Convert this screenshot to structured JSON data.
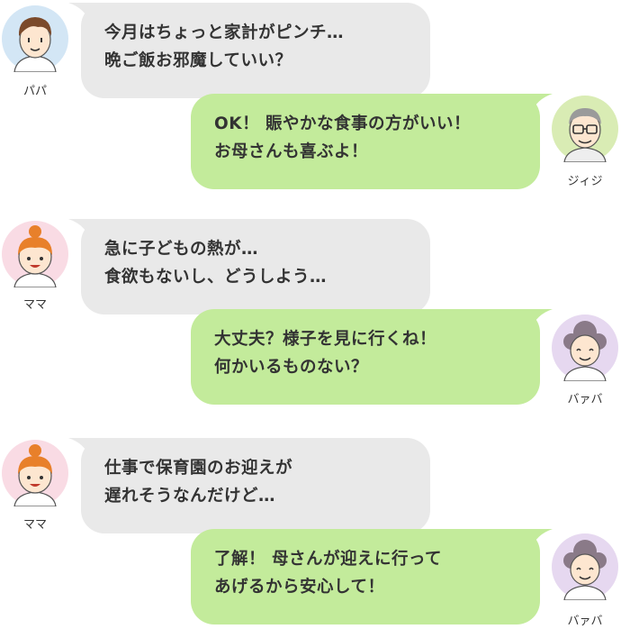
{
  "colors": {
    "gray_bubble": "#e9e9e9",
    "green_bubble": "#c3eb9b",
    "papa_avatar_bg": "#d3e6f5",
    "jiji_avatar_bg": "#d9ecb4",
    "mama_avatar_bg": "#f9dbe4",
    "baba_avatar_bg": "#e6d8f0"
  },
  "messages": [
    {
      "speaker": "パパ",
      "avatar_icon": "papa-avatar-icon",
      "lines": [
        "今月はちょっと家計がピンチ…",
        "晩ご飯お邪魔していい？"
      ]
    },
    {
      "speaker": "ジィジ",
      "avatar_icon": "jiji-avatar-icon",
      "lines": [
        "OK！ 賑やかな食事の方がいい！",
        "お母さんも喜ぶよ！"
      ]
    },
    {
      "speaker": "ママ",
      "avatar_icon": "mama-avatar-icon",
      "lines": [
        "急に子どもの熱が…",
        "食欲もないし、どうしよう…"
      ]
    },
    {
      "speaker": "バァバ",
      "avatar_icon": "baba-avatar-icon",
      "lines": [
        "大丈夫？様子を見に行くね！",
        "何かいるものない？"
      ]
    },
    {
      "speaker": "ママ",
      "avatar_icon": "mama-avatar-icon",
      "lines": [
        "仕事で保育園のお迎えが",
        "遅れそうなんだけど…"
      ]
    },
    {
      "speaker": "バァバ",
      "avatar_icon": "baba-avatar-icon",
      "lines": [
        "了解！ 母さんが迎えに行って",
        "あげるから安心して！"
      ]
    }
  ]
}
